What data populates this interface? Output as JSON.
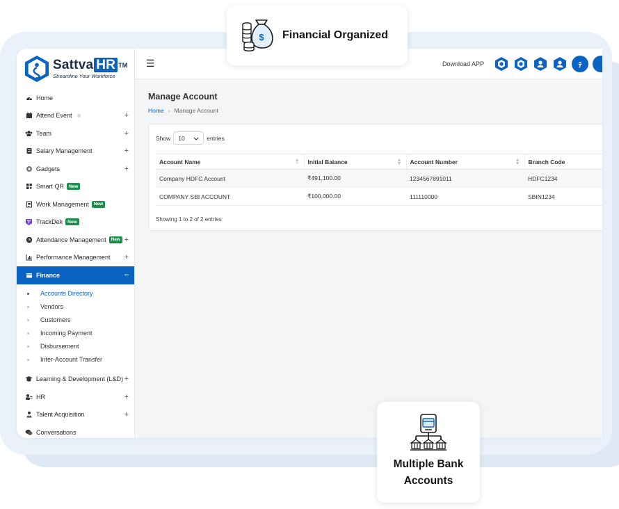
{
  "brand": {
    "name": "Sattva",
    "name_hr": "HR",
    "tm": "TM",
    "tagline": "Streamline Your Workforce",
    "accent_color": "#0b63c4"
  },
  "sidebar": {
    "items": [
      {
        "label": "Home",
        "icon": "dashboard-icon",
        "expandable": false
      },
      {
        "label": "Attend Event",
        "icon": "calendar-icon",
        "expandable": true
      },
      {
        "label": "Team",
        "icon": "users-icon",
        "expandable": true
      },
      {
        "label": "Salary Management",
        "icon": "wallet-icon",
        "expandable": true
      },
      {
        "label": "Gadgets",
        "icon": "gadget-icon",
        "expandable": true
      },
      {
        "label": "Smart QR",
        "icon": "qr-icon",
        "badge": "New",
        "expandable": false
      },
      {
        "label": "Work Management",
        "icon": "briefcase-icon",
        "badge": "New",
        "expandable": false
      },
      {
        "label": "TrackDek",
        "icon": "trackdek-icon",
        "badge": "New",
        "expandable": false
      },
      {
        "label": "Attendance Management",
        "icon": "clock-icon",
        "badge": "New",
        "expandable": true
      },
      {
        "label": "Performance Management",
        "icon": "chart-icon",
        "expandable": true
      },
      {
        "label": "Finance",
        "icon": "finance-icon",
        "expandable": true,
        "active": true,
        "toggle": "−"
      }
    ],
    "finance_sub": [
      {
        "label": "Accounts Directory",
        "active": true
      },
      {
        "label": "Vendors"
      },
      {
        "label": "Customers"
      },
      {
        "label": "Incoming Payment"
      },
      {
        "label": "Disbursement"
      },
      {
        "label": "Inter-Account Transfer"
      }
    ],
    "items_after": [
      {
        "label": "Learning & Development (L&D)",
        "icon": "graduation-icon",
        "expandable": true
      },
      {
        "label": "HR",
        "icon": "hr-icon",
        "expandable": true
      },
      {
        "label": "Talent Acquisition",
        "icon": "person-tie-icon",
        "expandable": true
      },
      {
        "label": "Conversations",
        "icon": "chat-icon",
        "expandable": false
      }
    ],
    "plus_symbol": "+"
  },
  "topbar": {
    "menu_icon": "☰",
    "download_label": "Download APP",
    "avatar_letter": "ﾃ"
  },
  "page": {
    "title": "Manage Account",
    "breadcrumb_home": "Home",
    "breadcrumb_sep": "›",
    "breadcrumb_current": "Manage Account"
  },
  "table": {
    "show_label": "Show",
    "entries_value": "10",
    "entries_label": "entries",
    "columns": [
      "Account Name",
      "Initial Balance",
      "Account Number",
      "Branch Code"
    ],
    "rows": [
      [
        "Company HDFC Account",
        "₹491,100.00",
        "1234567891011",
        "HDFC1234"
      ],
      [
        "COMPANY SBI ACCOUNT",
        "₹100,000.00",
        "111110000",
        "SBIN1234"
      ]
    ],
    "footer": "Showing 1 to 2 of 2 entries"
  },
  "cards": {
    "top_title": "Financial Organized",
    "bottom_title": "Multiple Bank Accounts"
  }
}
